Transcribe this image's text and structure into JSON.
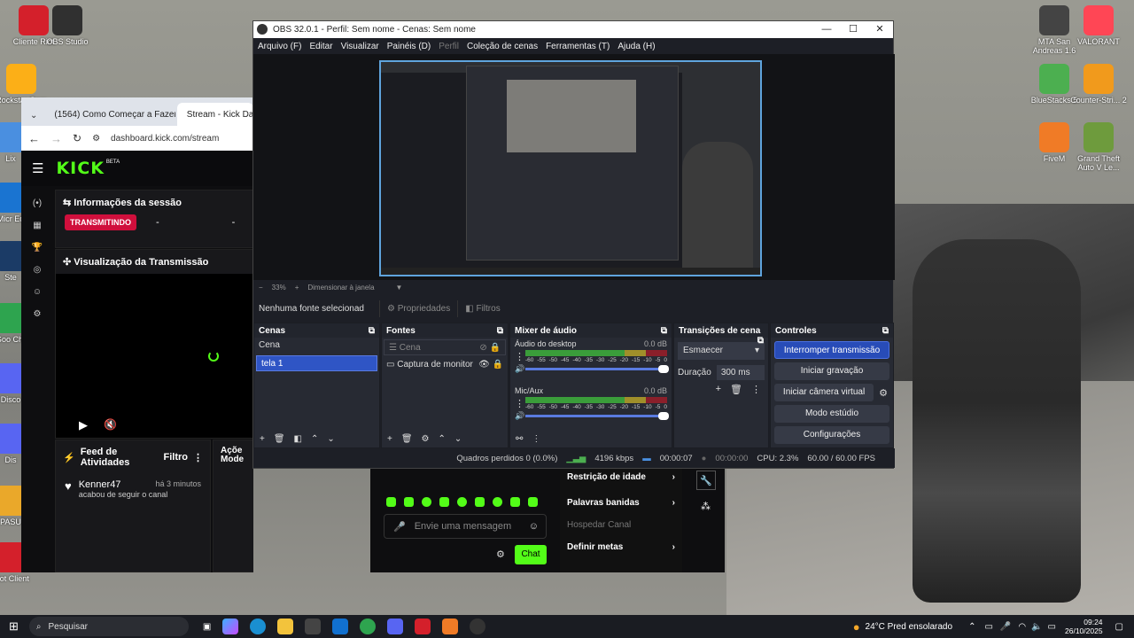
{
  "desktop": {
    "icons_left": [
      {
        "label": "Cliente Riot",
        "color": "#d4202b"
      },
      {
        "label": "OBS Studio",
        "color": "#303030"
      },
      {
        "label": "Rockstar Gam",
        "color": "#fcaf17"
      },
      {
        "label": "Lix",
        "color": "#4a8fe0"
      },
      {
        "label": "Micr Ed",
        "color": "#1a74d1"
      },
      {
        "label": "Ste",
        "color": "#1b3b66"
      },
      {
        "label": "Goo Chr",
        "color": "#2ea44f"
      },
      {
        "label": "Disco",
        "color": "#5865f2"
      },
      {
        "label": "Dis",
        "color": "#5865f2"
      },
      {
        "label": "PASU",
        "color": "#eaa82a"
      },
      {
        "label": "Riot Client",
        "color": "#d4202b"
      }
    ],
    "icons_right": [
      {
        "label": "MTA San Andreas 1.6",
        "color": "#444"
      },
      {
        "label": "VALORANT",
        "color": "#ff4655"
      },
      {
        "label": "BlueStacks 5",
        "color": "#4caf50"
      },
      {
        "label": "Counter-Stri... 2",
        "color": "#f19a1c"
      },
      {
        "label": "FiveM",
        "color": "#f07b26"
      },
      {
        "label": "Grand Theft Auto V Le...",
        "color": "#6e9b3d"
      }
    ]
  },
  "browser": {
    "tabs": [
      {
        "label": "(1564) Como Começar a Fazer",
        "icon": "youtube-icon"
      },
      {
        "label": "Stream - Kick Da",
        "icon": "kick-icon"
      }
    ],
    "url": "dashboard.kick.com/stream",
    "logo": "KICK",
    "logo_badge": "BETA",
    "session_title": "Informações da sessão",
    "live_label": "TRANSMITINDO",
    "stat_1": "-",
    "stat_2": "-",
    "preview_title": "Visualização da Transmissão",
    "feed_title": "Feed de Atividades",
    "feed_filter": "Filtro",
    "feed_user": "Kenner47",
    "feed_time": "há 3 minutos",
    "feed_text": "acabou de seguir o canal",
    "actions_title": "Açõe Mode",
    "chat_placeholder": "Envie uma mensagem",
    "chat_button": "Chat",
    "menu_items": [
      "Restrição de idade",
      "Palavras banidas",
      "Hospedar Canal",
      "Definir metas"
    ]
  },
  "obs": {
    "title": "OBS 32.0.1 - Perfil: Sem nome - Cenas: Sem nome",
    "menus": [
      "Arquivo (F)",
      "Editar",
      "Visualizar",
      "Painéis (D)",
      "Perfil",
      "Coleção de cenas",
      "Ferramentas (T)",
      "Ajuda (H)"
    ],
    "zoom": "33%",
    "zoom_mode": "Dimensionar à janela",
    "no_source": "Nenhuma fonte selecionad",
    "properties": "Propriedades",
    "filters": "Filtros",
    "scenes_title": "Cenas",
    "scenes": [
      "Cena",
      "tela 1"
    ],
    "sources_title": "Fontes",
    "sources": [
      "Cena",
      "Captura de monitor"
    ],
    "mixer_title": "Mixer de áudio",
    "channels": [
      {
        "name": "Áudio do desktop",
        "db": "0.0 dB"
      },
      {
        "name": "Mic/Aux",
        "db": "0.0 dB"
      }
    ],
    "scale": [
      "-60",
      "-55",
      "-50",
      "-45",
      "-40",
      "-35",
      "-30",
      "-25",
      "-20",
      "-15",
      "-10",
      "-5",
      "0"
    ],
    "transitions_title": "Transições de cena",
    "transition": "Esmaecer",
    "duration_label": "Duração",
    "duration": "300 ms",
    "controls_title": "Controles",
    "controls": [
      "Interromper transmissão",
      "Iniciar gravação",
      "Iniciar câmera virtual",
      "Modo estúdio",
      "Configurações"
    ],
    "status": {
      "dropped": "Quadros perdidos 0 (0.0%)",
      "bitrate": "4196 kbps",
      "stream_time": "00:00:07",
      "rec_time": "00:00:00",
      "cpu": "CPU: 2.3%",
      "fps": "60.00 / 60.00 FPS"
    }
  },
  "taskbar": {
    "search": "Pesquisar",
    "weather": "24°C  Pred ensolarado",
    "time": "09:24",
    "date": "26/10/2025"
  }
}
